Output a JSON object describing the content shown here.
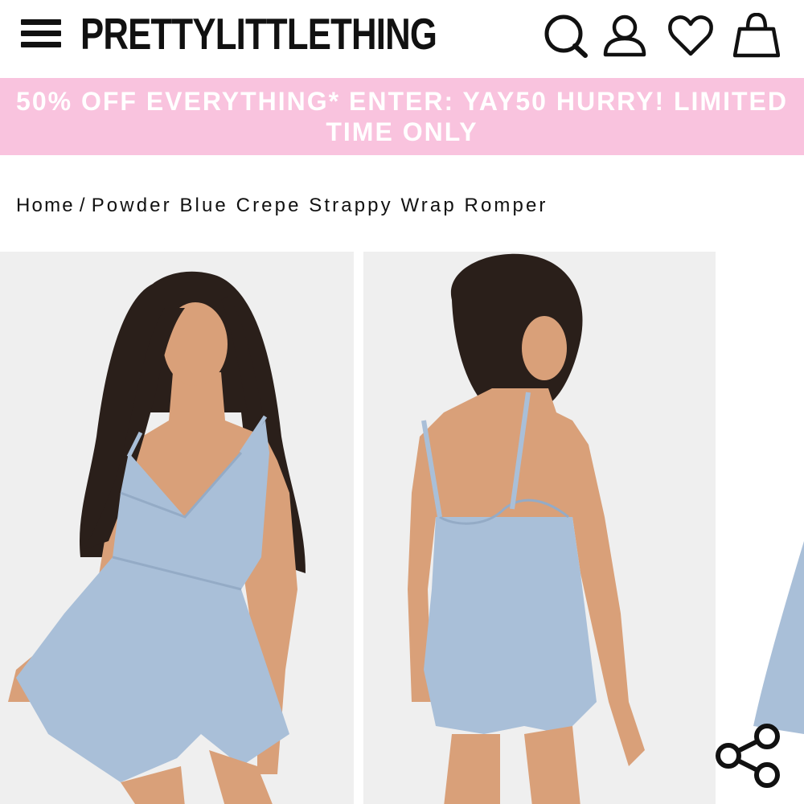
{
  "header": {
    "logo_text": "PRETTYLITTLETHING",
    "menu_icon": "hamburger-menu-icon",
    "search_icon": "search-icon",
    "account_icon": "user-icon",
    "wishlist_icon": "heart-icon",
    "bag_icon": "shopping-bag-icon"
  },
  "promo": {
    "text": "50% OFF EVERYTHING* ENTER: YAY50 HURRY! LIMITED TIME ONLY",
    "background": "#f9c3de",
    "color": "#ffffff"
  },
  "breadcrumb": {
    "home": "Home",
    "separator": "/",
    "current": "Powder Blue Crepe Strappy Wrap Romper"
  },
  "gallery": {
    "images": [
      {
        "description_icon": "product-front-photo"
      },
      {
        "description_icon": "product-back-photo"
      },
      {
        "description_icon": "product-side-photo"
      }
    ],
    "share_icon": "share-icon"
  },
  "colors": {
    "romper": "#a9bfd8",
    "backdrop": "#efefef",
    "text": "#111111"
  }
}
